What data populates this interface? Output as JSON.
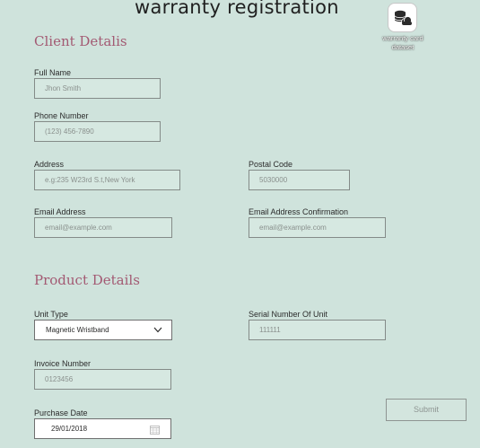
{
  "page": {
    "title": "warranty registration"
  },
  "desktop_icon": {
    "name": "warranty card dataset",
    "icon": "cloud-database-icon"
  },
  "client": {
    "section_title": "Client Detalis",
    "full_name": {
      "label": "Full Name",
      "placeholder": "Jhon Smith"
    },
    "phone": {
      "label": "Phone Number",
      "placeholder": "(123) 456-7890"
    },
    "address": {
      "label": "Address",
      "placeholder": "e.g:235 W23rd S.t,New York"
    },
    "postal_code": {
      "label": "Postal Code",
      "placeholder": "5030000"
    },
    "email": {
      "label": "Email Address",
      "placeholder": "email@example.com"
    },
    "email_confirm": {
      "label": "Email Address Confirmation",
      "placeholder": "email@example.com"
    }
  },
  "product": {
    "section_title": "Product Details",
    "unit_type": {
      "label": "Unit Type",
      "value": "Magnetic Wristband"
    },
    "serial": {
      "label": "Serial Number Of Unit",
      "placeholder": "111111"
    },
    "invoice": {
      "label": "Invoice Number",
      "placeholder": "0123456"
    },
    "purchase_date": {
      "label": "Purchase Date",
      "value": "29/01/2018"
    }
  },
  "submit": {
    "label": "Submit"
  },
  "colors": {
    "background": "#cfe3dc",
    "section_accent": "#a35a73",
    "field_border": "#848b88"
  }
}
